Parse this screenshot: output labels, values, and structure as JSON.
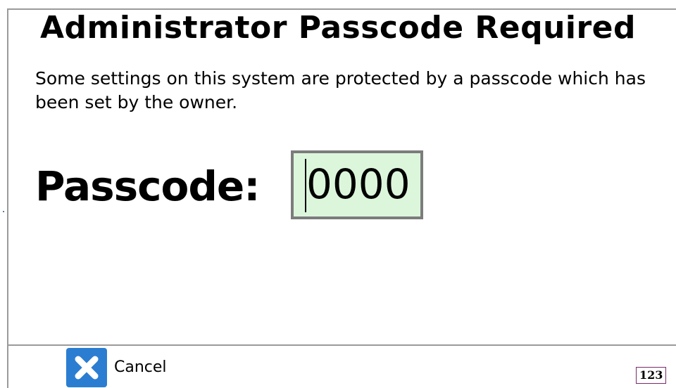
{
  "dialog": {
    "title": "Administrator Passcode Required",
    "message": "Some settings on this system are protected by a passcode which has been set by the owner."
  },
  "passcode": {
    "label": "Passcode:",
    "value": "0000",
    "field_color": "#dcf6dc"
  },
  "footer": {
    "cancel_label": "Cancel",
    "cancel_icon": "close-icon",
    "cancel_icon_color": "#2b7dd2",
    "keyboard_mode": "123"
  }
}
